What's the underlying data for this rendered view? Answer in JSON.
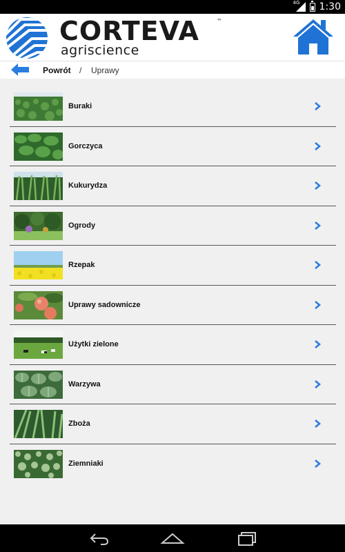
{
  "status_bar": {
    "network": "4G",
    "time": "1:30",
    "battery_level": 0.5
  },
  "header": {
    "brand_name": "CORTEVA",
    "brand_trademark": "™",
    "brand_subtitle": "agriscience",
    "home_icon": "home-icon",
    "logo_icon": "corteva-logo-icon"
  },
  "breadcrumb": {
    "back_icon": "arrow-left-icon",
    "back_label": "Powrót",
    "separator": "/",
    "current": "Uprawy"
  },
  "crops": [
    {
      "label": "Buraki",
      "thumbnail": "beet-field-photo"
    },
    {
      "label": "Gorczyca",
      "thumbnail": "mustard-leaves-photo"
    },
    {
      "label": "Kukurydza",
      "thumbnail": "corn-field-photo"
    },
    {
      "label": "Ogrody",
      "thumbnail": "garden-photo"
    },
    {
      "label": "Rzepak",
      "thumbnail": "rapeseed-field-photo"
    },
    {
      "label": "Uprawy sadownicze",
      "thumbnail": "apples-photo"
    },
    {
      "label": "Użytki zielone",
      "thumbnail": "pasture-photo"
    },
    {
      "label": "Warzywa",
      "thumbnail": "vegetables-photo"
    },
    {
      "label": "Zboża",
      "thumbnail": "cereals-photo"
    },
    {
      "label": "Ziemniaki",
      "thumbnail": "potato-field-photo"
    }
  ],
  "nav_bar": {
    "back_icon": "nav-back-icon",
    "home_icon": "nav-home-icon",
    "recents_icon": "nav-recents-icon"
  },
  "colors": {
    "accent_blue": "#2a7de1",
    "background": "#f0f0f0",
    "divider": "#555555"
  }
}
